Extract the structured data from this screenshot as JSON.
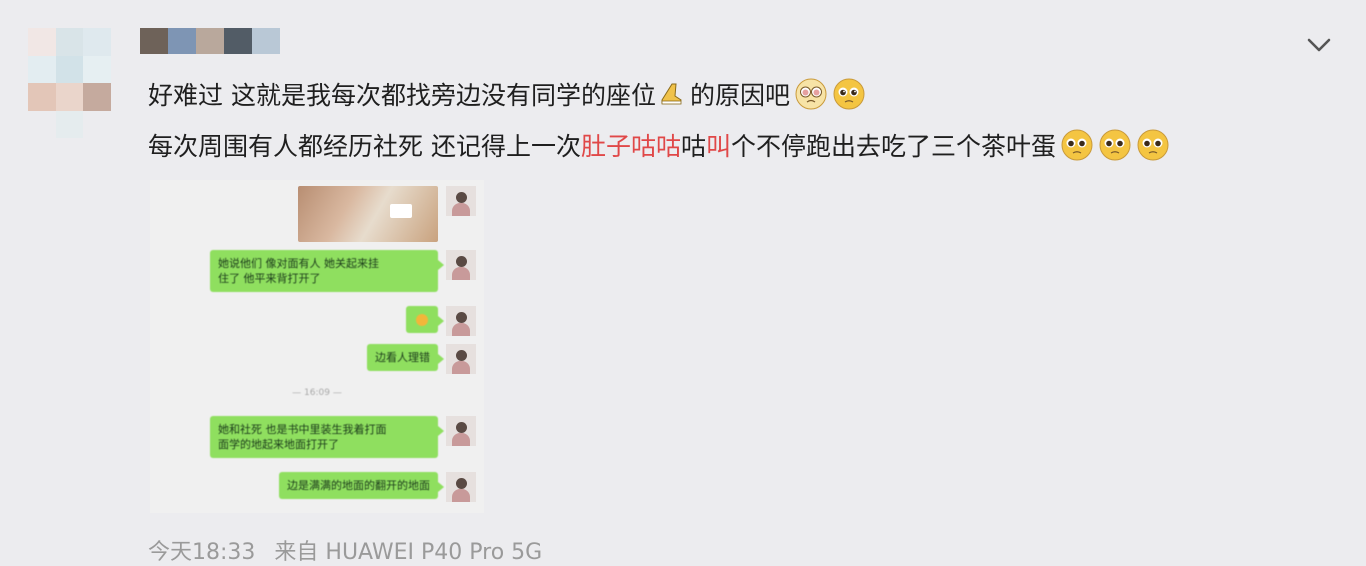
{
  "post": {
    "line1": {
      "text_a": "好难过 这就是我每次都找旁边没有同学的座位",
      "text_b": " 的原因吧"
    },
    "line2": {
      "text_a": "每次周围有人都经历社死 还记得上一次",
      "highlight_a": "肚子咕咕",
      "text_b": "咕",
      "highlight_b": "叫",
      "text_c": "个不停跑出去吃了三个茶叶蛋"
    }
  },
  "footer": {
    "time": "今天18:33",
    "source": "来自 HUAWEI P40 Pro 5G"
  },
  "chat": {
    "messages": [
      "她说他们 像对面有人 她关起来挂\n住了 他平来背打开了",
      "",
      "边看人理错",
      "她和社死 也是书中里装生我着打面\n面学的地起来地面打开了",
      "边是满满的地面的翻开的地面"
    ],
    "divider": "— 16:09 —"
  },
  "icons": [
    "chevron-down-icon",
    "sneaker-emoji",
    "pleading-face-emoji",
    "teary-face-emoji"
  ],
  "colors": {
    "background": "#ececef",
    "text": "#1f1f1f",
    "highlight": "#e04848",
    "footer": "#9a9a9a",
    "bubble": "#8fdf5f"
  }
}
